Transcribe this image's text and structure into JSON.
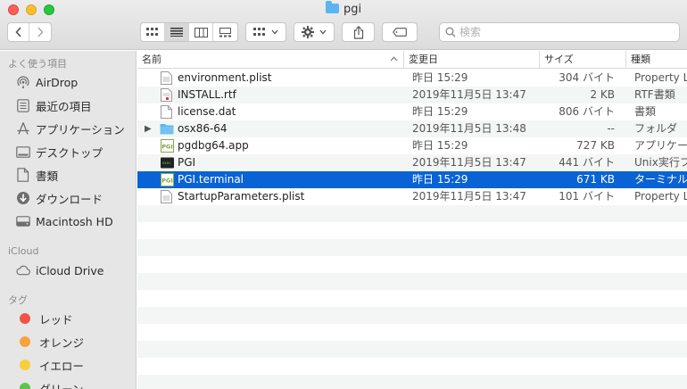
{
  "window": {
    "title": "pgi"
  },
  "toolbar": {
    "back_icon": "chevron-left-icon",
    "forward_icon": "chevron-right-icon",
    "view_modes": [
      "icon-view",
      "list-view",
      "column-view",
      "gallery-view"
    ],
    "search_placeholder": "検索"
  },
  "sidebar": {
    "favorites_header": "よく使う項目",
    "favorites": [
      {
        "label": "AirDrop",
        "icon": "airdrop-icon"
      },
      {
        "label": "最近の項目",
        "icon": "recents-icon"
      },
      {
        "label": "アプリケーション",
        "icon": "applications-icon"
      },
      {
        "label": "デスクトップ",
        "icon": "desktop-icon"
      },
      {
        "label": "書類",
        "icon": "documents-icon"
      },
      {
        "label": "ダウンロード",
        "icon": "downloads-icon"
      },
      {
        "label": "Macintosh HD",
        "icon": "disk-icon"
      }
    ],
    "icloud_header": "iCloud",
    "icloud": [
      {
        "label": "iCloud Drive",
        "icon": "cloud-icon"
      }
    ],
    "tags_header": "タグ",
    "tags": [
      {
        "label": "レッド",
        "color": "#f2524a"
      },
      {
        "label": "オレンジ",
        "color": "#f7a23b"
      },
      {
        "label": "イエロー",
        "color": "#f6cf3b"
      },
      {
        "label": "グリーン",
        "color": "#5cc34d"
      }
    ]
  },
  "list": {
    "columns": {
      "name": "名前",
      "date": "変更日",
      "size": "サイズ",
      "kind": "種類"
    },
    "rows": [
      {
        "name": "environment.plist",
        "date": "昨日 15:29",
        "size": "304 バイト",
        "kind": "Property L",
        "icon": "plist-icon"
      },
      {
        "name": "INSTALL.rtf",
        "date": "2019年11月5日 13:47",
        "size": "2 KB",
        "kind": "RTF書類",
        "icon": "rtf-icon"
      },
      {
        "name": "license.dat",
        "date": "昨日 15:29",
        "size": "806 バイト",
        "kind": "書類",
        "icon": "document-icon"
      },
      {
        "name": "osx86-64",
        "date": "2019年11月5日 13:48",
        "size": "--",
        "kind": "フォルダ",
        "icon": "folder-icon"
      },
      {
        "name": "pgdbg64.app",
        "date": "昨日 15:29",
        "size": "727 KB",
        "kind": "アプリケーシ",
        "icon": "pgi-app-icon"
      },
      {
        "name": "PGI",
        "date": "2019年11月5日 13:47",
        "size": "441 バイト",
        "kind": "Unix実行フ",
        "icon": "terminal-exec-icon"
      },
      {
        "name": "PGI.terminal",
        "date": "昨日 15:29",
        "size": "671 KB",
        "kind": "ターミナル設",
        "icon": "pgi-app-icon"
      },
      {
        "name": "StartupParameters.plist",
        "date": "2019年11月5日 13:47",
        "size": "101 バイト",
        "kind": "Property L",
        "icon": "plist-icon"
      }
    ],
    "selected_index": 6
  }
}
